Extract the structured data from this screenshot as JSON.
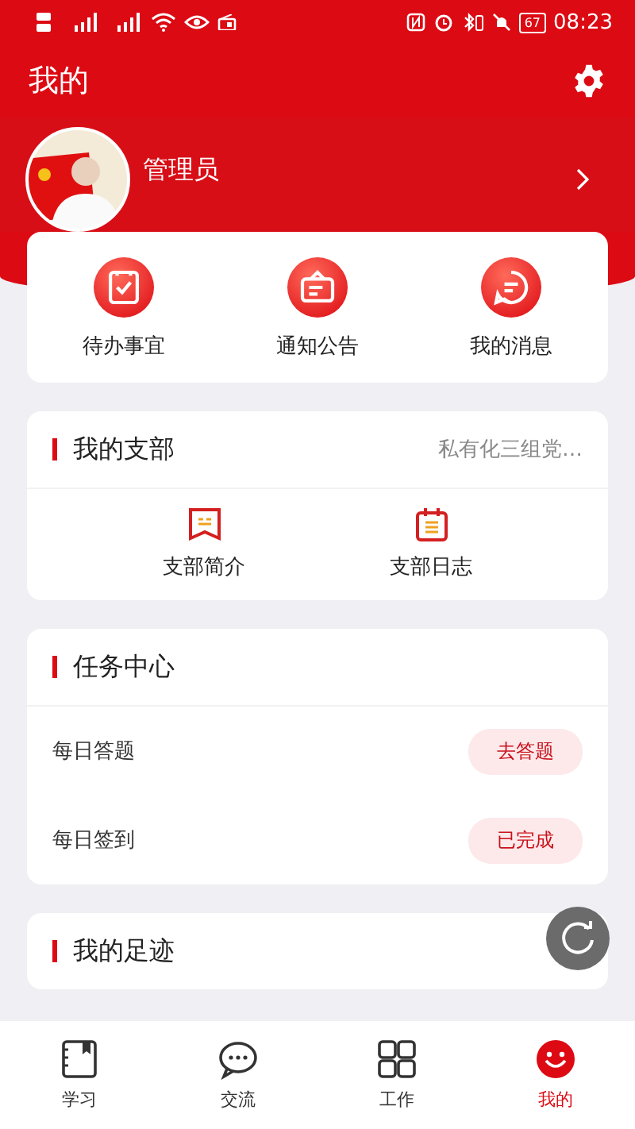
{
  "status_bar": {
    "battery": "67",
    "time": "08:23"
  },
  "header": {
    "title": "我的"
  },
  "profile": {
    "name": "管理员"
  },
  "quick_actions": [
    {
      "label": "待办事宜",
      "kind": "todo"
    },
    {
      "label": "通知公告",
      "kind": "notice"
    },
    {
      "label": "我的消息",
      "kind": "message"
    }
  ],
  "branch": {
    "title": "我的支部",
    "value": "私有化三组党…",
    "items": [
      {
        "label": "支部简介",
        "kind": "intro"
      },
      {
        "label": "支部日志",
        "kind": "log"
      }
    ]
  },
  "tasks": {
    "title": "任务中心",
    "items": [
      {
        "label": "每日答题",
        "action": "去答题"
      },
      {
        "label": "每日签到",
        "action": "已完成"
      }
    ]
  },
  "footprints": {
    "title": "我的足迹"
  },
  "tab_bar": [
    {
      "label": "学习",
      "kind": "study",
      "selected": false
    },
    {
      "label": "交流",
      "kind": "chat",
      "selected": false
    },
    {
      "label": "工作",
      "kind": "work",
      "selected": false
    },
    {
      "label": "我的",
      "kind": "me",
      "selected": true
    }
  ]
}
